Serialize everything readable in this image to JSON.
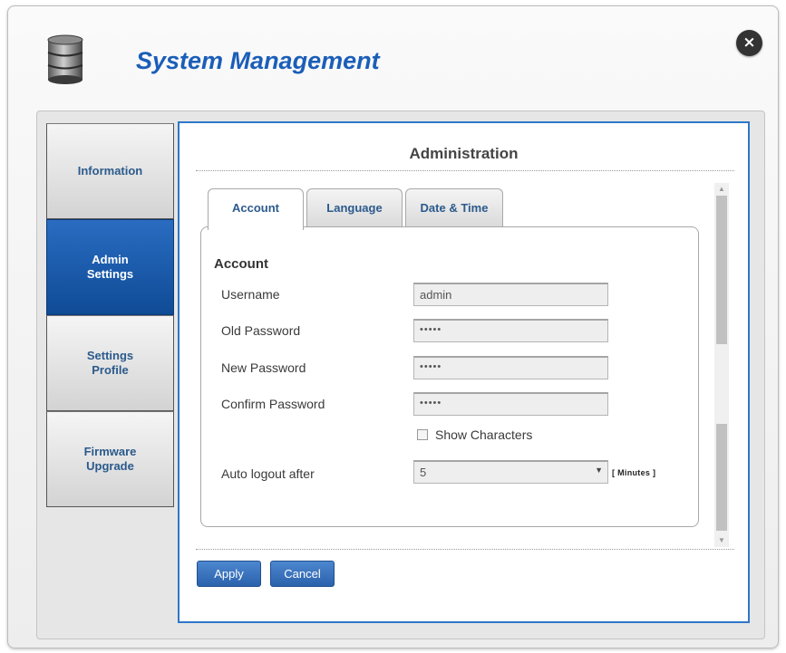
{
  "window": {
    "title": "System Management",
    "close_icon": "×"
  },
  "sidebar": {
    "items": [
      {
        "label": "Information",
        "active": false
      },
      {
        "label": "Admin\nSettings",
        "active": true
      },
      {
        "label": "Settings\nProfile",
        "active": false
      },
      {
        "label": "Firmware\nUpgrade",
        "active": false
      }
    ]
  },
  "main": {
    "title": "Administration",
    "tabs": [
      {
        "label": "Account",
        "active": true
      },
      {
        "label": "Language",
        "active": false
      },
      {
        "label": "Date & Time",
        "active": false
      }
    ],
    "account": {
      "heading": "Account",
      "username_label": "Username",
      "username_value": "admin",
      "old_password_label": "Old Password",
      "old_password_value": "•••••",
      "new_password_label": "New Password",
      "new_password_value": "•••••",
      "confirm_password_label": "Confirm Password",
      "confirm_password_value": "•••••",
      "show_characters_label": "Show Characters",
      "show_characters_checked": false,
      "auto_logout_label": "Auto logout after",
      "auto_logout_value": "5",
      "auto_logout_unit": "[ Minutes ]"
    },
    "buttons": {
      "apply": "Apply",
      "cancel": "Cancel"
    }
  },
  "colors": {
    "title": "#1b5eb8",
    "active_menu": "#1558a8",
    "content_border": "#2d78c8",
    "button": "#3a74bf"
  }
}
